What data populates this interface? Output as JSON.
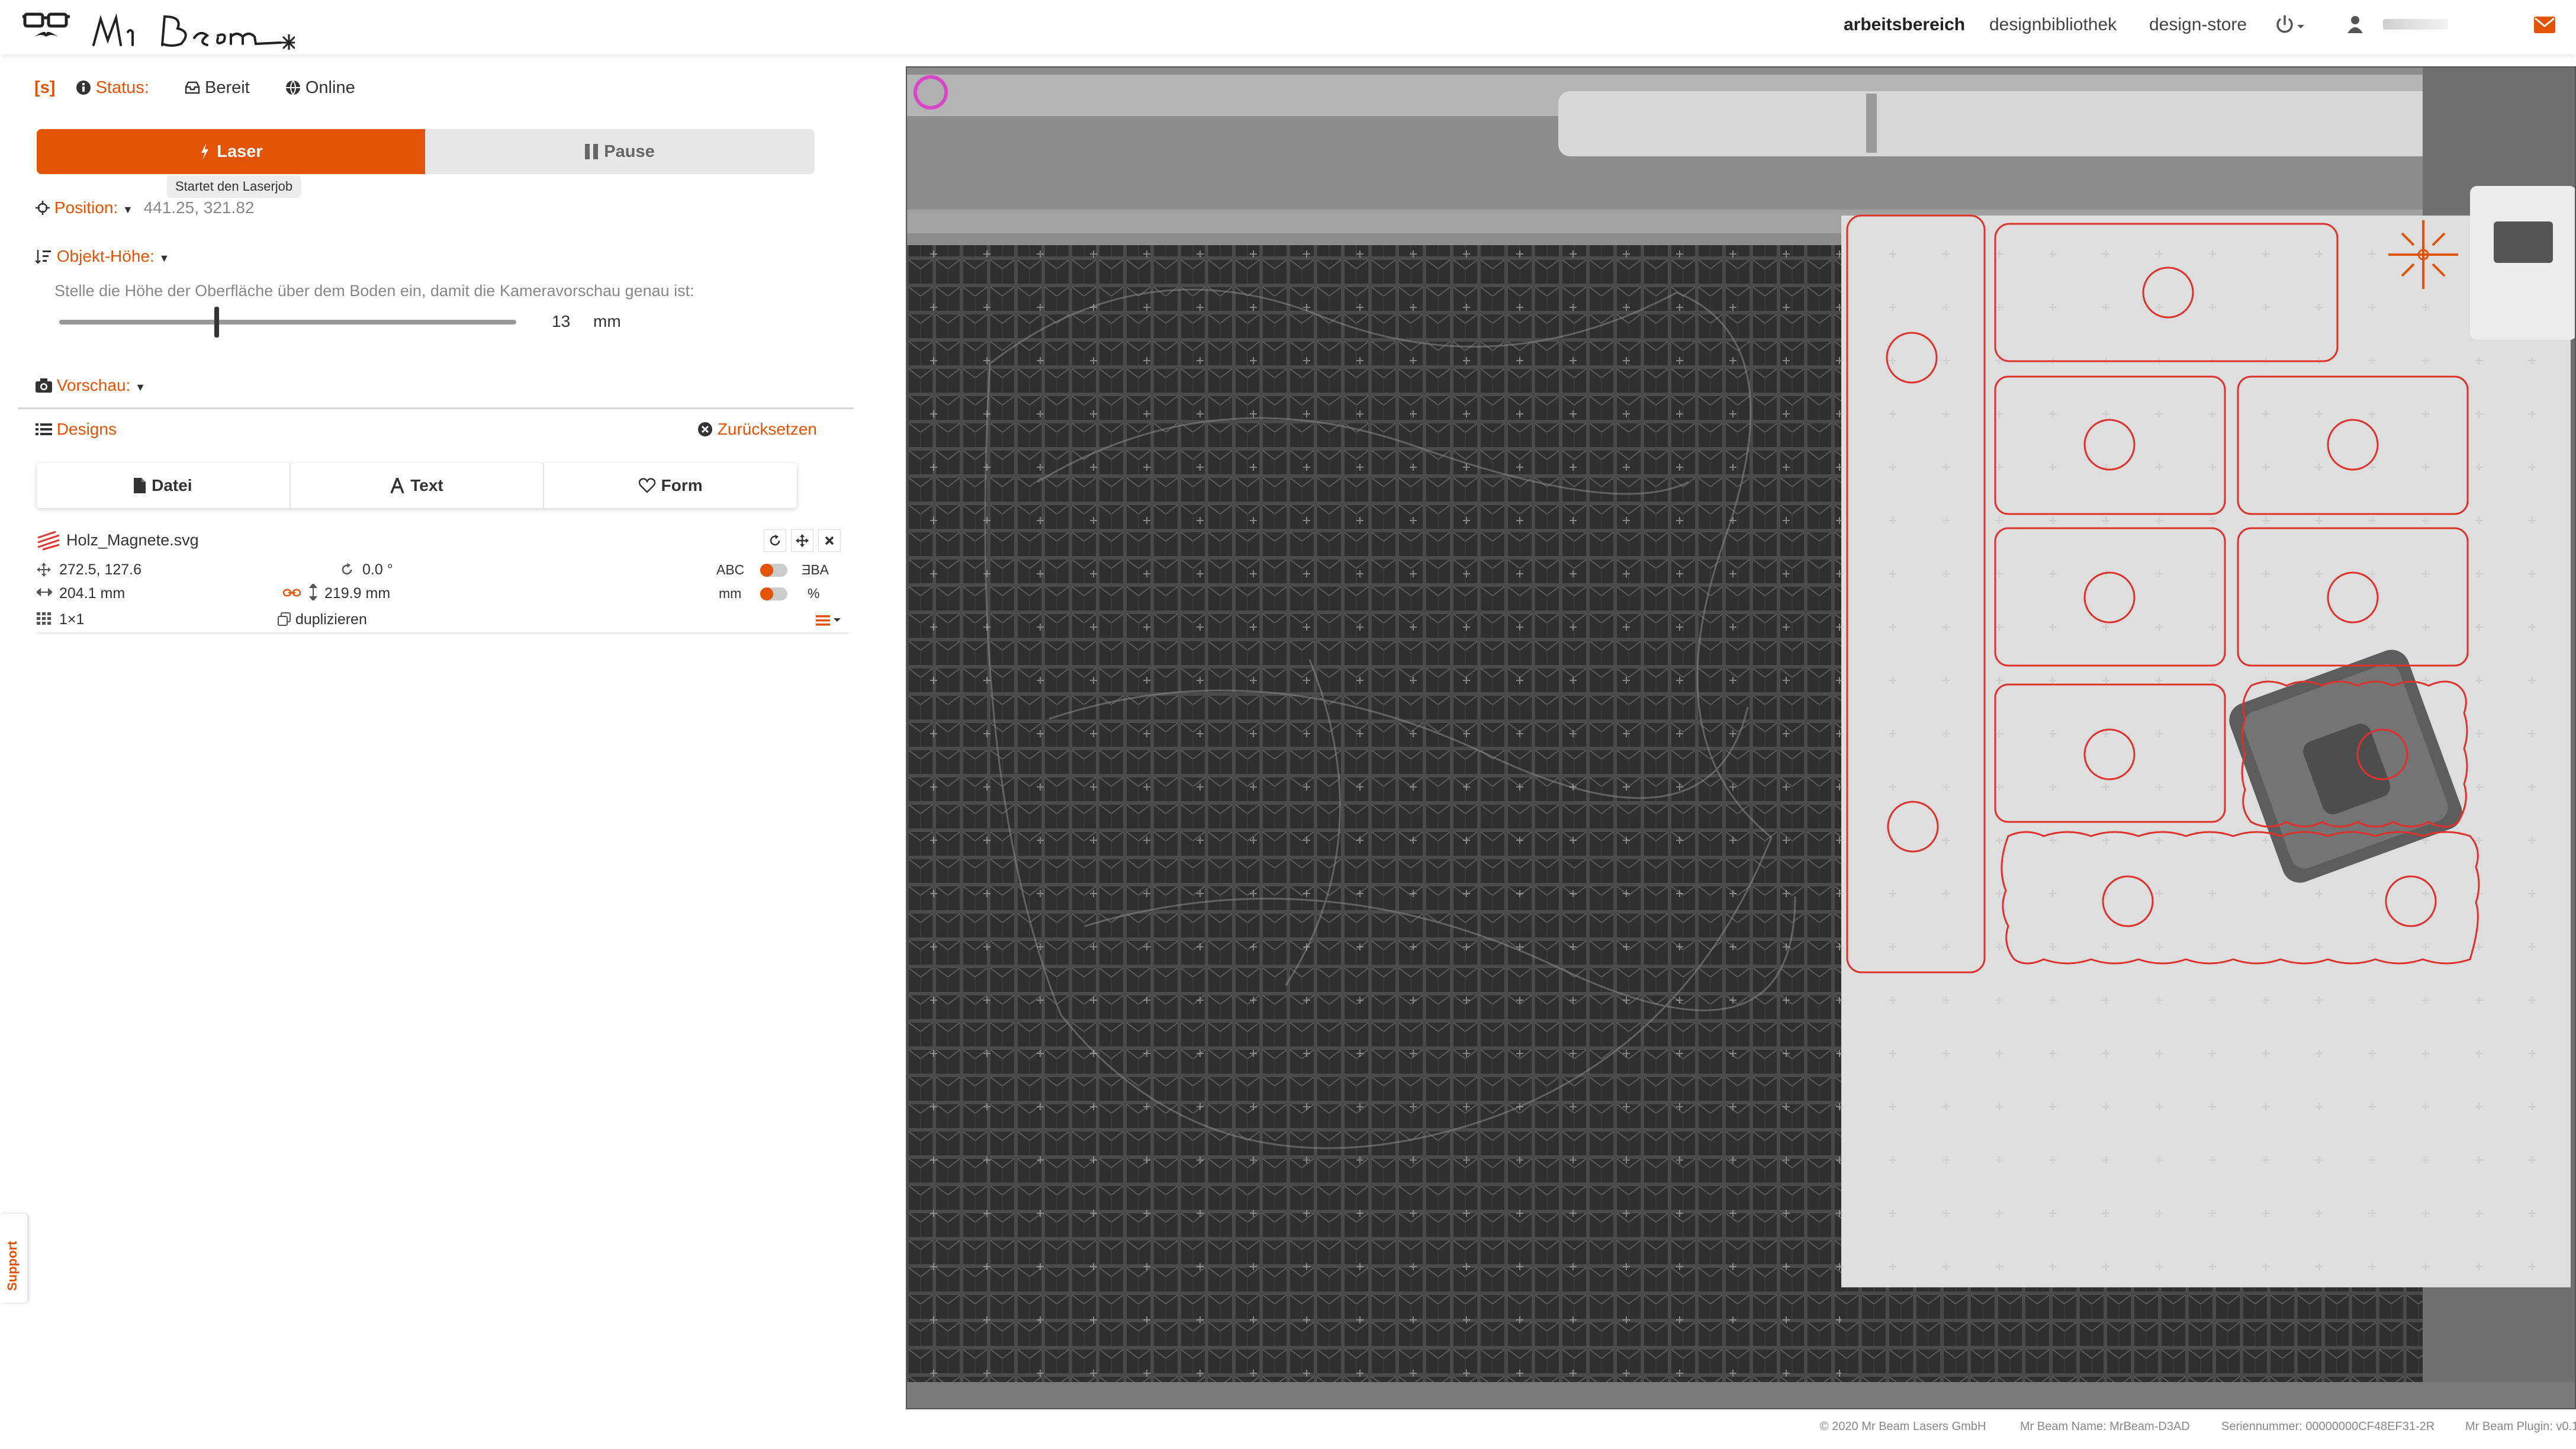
{
  "brand": {
    "name": "Mr Beam"
  },
  "nav": {
    "items": [
      {
        "label": "arbeitsbereich",
        "active": true
      },
      {
        "label": "designbibliothek",
        "active": false
      },
      {
        "label": "design-store",
        "active": false
      }
    ],
    "power_icon": "power-icon",
    "user_icon": "user-icon",
    "user_name": "[blurred]",
    "mail_icon": "envelope-icon"
  },
  "status": {
    "tag": "[s]",
    "label": "Status:",
    "state": "Bereit",
    "connection": "Online"
  },
  "controls": {
    "laser_label": "Laser",
    "pause_label": "Pause",
    "laser_tooltip": "Startet den Laserjob"
  },
  "position": {
    "label": "Position:",
    "value": "441.25, 321.82"
  },
  "object_height": {
    "label": "Objekt-Höhe:",
    "hint": "Stelle die Höhe der Oberfläche über dem Boden ein, damit die Kameravorschau genau ist:",
    "value": "13",
    "unit": "mm",
    "slider_fraction": 0.35
  },
  "preview": {
    "label": "Vorschau:"
  },
  "designs": {
    "label": "Designs",
    "reset_label": "Zurücksetzen",
    "tabs": [
      {
        "label": "Datei",
        "icon": "file-icon"
      },
      {
        "label": "Text",
        "icon": "text-icon"
      },
      {
        "label": "Form",
        "icon": "heart-icon"
      }
    ],
    "item": {
      "filename": "Holz_Magnete.svg",
      "position": "272.5, 127.6",
      "rotation": "0.0 °",
      "width": "204.1 mm",
      "height": "219.9 mm",
      "grid": "1×1",
      "duplicate_label": "duplizieren",
      "mirror_left": "ABC",
      "mirror_right": "ƎBA",
      "unit_left": "mm",
      "unit_right": "%"
    }
  },
  "support": {
    "label": "Support"
  },
  "footer": {
    "copyright": "© 2020 Mr Beam Lasers GmbH",
    "name": "Mr Beam Name: MrBeam-D3AD",
    "serial": "Seriennummer: 00000000CF48EF31-2R",
    "plugin": "Mr Beam Plugin: v0.1"
  },
  "colors": {
    "accent": "#e25303",
    "cut_line": "#e0312a"
  }
}
